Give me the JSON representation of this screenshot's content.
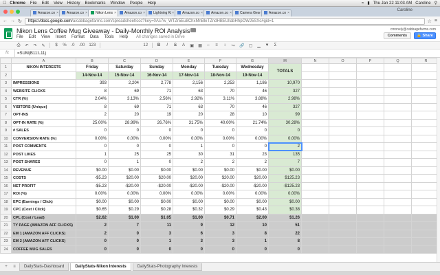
{
  "mac_menu": {
    "app": "Chrome",
    "items": [
      "File",
      "Edit",
      "View",
      "History",
      "Bookmarks",
      "Window",
      "People",
      "Help"
    ],
    "clock": "Thu Jan 22  11:03 AM",
    "user": "Caroline"
  },
  "browser": {
    "tabs": [
      {
        "label": "Amazon.co"
      },
      {
        "label": "Amazon.co"
      },
      {
        "label": "Nikon Lens"
      },
      {
        "label": "Amazon.co"
      },
      {
        "label": "Lightning Ki"
      },
      {
        "label": "Amazon.co"
      },
      {
        "label": "Amazon.co"
      },
      {
        "label": "Camera Gea"
      },
      {
        "label": "Amazon.co"
      }
    ],
    "active_tab": 2,
    "url_host": "https://docs.google.com",
    "url_rest": "/a/cabbagefarms.com/spreadsheet/ccc?key=0As7w_WTZr5Eu8ChxMnBleTZndHBEUllabHhpOWJ5SXc#gid=1"
  },
  "docs": {
    "title": "Nikon Lens Coffee Mug Giveaway - Daily-Monthly ROI Analysis",
    "menu": [
      "File",
      "Edit",
      "View",
      "Insert",
      "Format",
      "Data",
      "Tools",
      "Help"
    ],
    "save_status": "All changes saved in Drive",
    "user_email": "cmonely@cabbagefarms.com",
    "comments_label": "Comments",
    "share_label": "Share"
  },
  "toolbar": {
    "zoom_pct": "%",
    "decimals": ".0",
    "more_decimals": ".00",
    "format": "123",
    "font_size": "12",
    "bold": "B",
    "italic": "I",
    "strike": "S",
    "text_color": "A"
  },
  "formula": {
    "fx": "fx",
    "value": "=SUM(B11:L11)"
  },
  "columns": [
    "A",
    "B",
    "C",
    "D",
    "E",
    "F",
    "G",
    "M",
    "N",
    "O",
    "P",
    "Q",
    "R"
  ],
  "header_row": {
    "label": "NIKON INTERESTS",
    "days": [
      "Friday",
      "Saturday",
      "Sunday",
      "Monday",
      "Tuesday",
      "Wednesday"
    ],
    "totals": "TOTALS"
  },
  "date_row": [
    "14-Nov-14",
    "15-Nov-14",
    "16-Nov-14",
    "17-Nov-14",
    "18-Nov-14",
    "19-Nov-14"
  ],
  "rows": [
    {
      "n": "3",
      "label": "IMPRESSIONS",
      "v": [
        "393",
        "2,204",
        "2,778",
        "2,156",
        "2,253",
        "1,186"
      ],
      "t": "10,970"
    },
    {
      "n": "4",
      "label": "WEBSITE CLICKS",
      "v": [
        "8",
        "69",
        "71",
        "63",
        "70",
        "46"
      ],
      "t": "327"
    },
    {
      "n": "5",
      "label": "CTR (%)",
      "v": [
        "2.04%",
        "3.13%",
        "2.56%",
        "2.92%",
        "3.11%",
        "3.88%"
      ],
      "t": "2.98%"
    },
    {
      "n": "6",
      "label": "VISITORS (Unique)",
      "v": [
        "8",
        "69",
        "71",
        "63",
        "70",
        "46"
      ],
      "t": "327"
    },
    {
      "n": "7",
      "label": "OPT-INS",
      "v": [
        "2",
        "20",
        "19",
        "20",
        "28",
        "10"
      ],
      "t": "99"
    },
    {
      "n": "8",
      "label": "OPT-IN RATE (%)",
      "v": [
        "25.00%",
        "28.99%",
        "26.76%",
        "31.75%",
        "40.00%",
        "21.74%"
      ],
      "t": "30.28%"
    },
    {
      "n": "9",
      "label": "# SALES",
      "v": [
        "0",
        "0",
        "0",
        "0",
        "0",
        "0"
      ],
      "t": "0"
    },
    {
      "n": "10",
      "label": "CONVERSION RATE (%)",
      "v": [
        "0.00%",
        "0.00%",
        "0.00%",
        "0.00%",
        "0.00%",
        "0.00%"
      ],
      "t": "0.00%"
    },
    {
      "n": "11",
      "label": "POST COMMENTS",
      "v": [
        "0",
        "0",
        "0",
        "1",
        "0",
        "0"
      ],
      "t": "2",
      "selected": true
    },
    {
      "n": "12",
      "label": "POST LIKES",
      "v": [
        "1",
        "25",
        "25",
        "30",
        "31",
        "23"
      ],
      "t": "135"
    },
    {
      "n": "13",
      "label": "POST SHARES",
      "v": [
        "0",
        "1",
        "0",
        "2",
        "2",
        "2"
      ],
      "t": "7"
    },
    {
      "n": "14",
      "label": "REVENUE",
      "v": [
        "$0.00",
        "$0.00",
        "$0.00",
        "$0.00",
        "$0.00",
        "$0.00"
      ],
      "t": "$0.00"
    },
    {
      "n": "15",
      "label": "COSTS",
      "v": [
        "-$5.23",
        "$20.00",
        "$20.00",
        "$20.00",
        "$20.00",
        "$20.00"
      ],
      "t": "$125.23"
    },
    {
      "n": "16",
      "label": "NET PROFIT",
      "v": [
        "-$5.23",
        "-$20.00",
        "-$20.00",
        "-$20.00",
        "-$20.00",
        "-$20.00"
      ],
      "t": "-$125.23"
    },
    {
      "n": "17",
      "label": "ROI (%)",
      "v": [
        "0.00%",
        "0.00%",
        "0.00%",
        "0.00%",
        "0.00%",
        "0.00%"
      ],
      "t": "0.00%"
    },
    {
      "n": "18",
      "label": "EPC (Earnings / Click)",
      "v": [
        "$0.00",
        "$0.00",
        "$0.00",
        "$0.00",
        "$0.00",
        "$0.00"
      ],
      "t": "$0.00"
    },
    {
      "n": "19",
      "label": "CPC (Cost / Click)",
      "v": [
        "$0.65",
        "$0.29",
        "$0.28",
        "$0.32",
        "$0.29",
        "$0.43"
      ],
      "t": "$0.38"
    },
    {
      "n": "20",
      "label": "CPL (Cost / Lead)",
      "v": [
        "$2.62",
        "$1.00",
        "$1.05",
        "$1.00",
        "$0.71",
        "$2.00"
      ],
      "t": "$1.26",
      "grey": true
    },
    {
      "n": "21",
      "label": "TY PAGE (AMAZON AFF CLICKS)",
      "v": [
        "2",
        "7",
        "11",
        "9",
        "12",
        "10"
      ],
      "t": "51",
      "grey": true
    },
    {
      "n": "22",
      "label": "EM 1 (AMAZON AFF CLICKS)",
      "v": [
        "2",
        "0",
        "3",
        "6",
        "3",
        "8"
      ],
      "t": "22",
      "grey": true
    },
    {
      "n": "23",
      "label": "EM 2 (AMAZON AFF CLICKS)",
      "v": [
        "0",
        "0",
        "1",
        "3",
        "3",
        "1"
      ],
      "t": "8",
      "grey": true
    },
    {
      "n": "24",
      "label": "COFFEE MUG SALES",
      "v": [
        "0",
        "0",
        "0",
        "0",
        "0",
        "0"
      ],
      "t": "0",
      "grey": true
    }
  ],
  "sheet_tabs": [
    "DailyStats-Dashboard",
    "DailyStats-Nikon Interests",
    "DailyStats-Photography Interests"
  ],
  "active_sheet": 1,
  "colors": {
    "green_fill": "#d9ead3",
    "grey_fill": "#cccccc",
    "selection": "#4d90fe",
    "share_blue": "#4d90fe"
  }
}
